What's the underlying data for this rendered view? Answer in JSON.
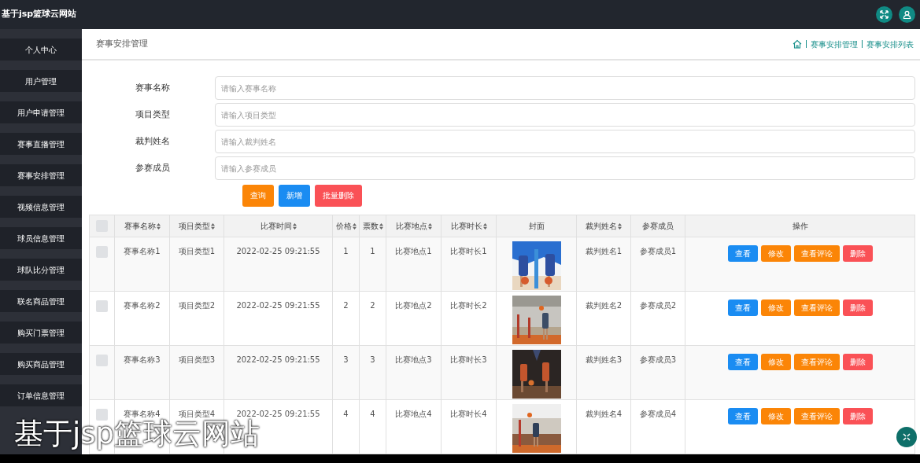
{
  "header": {
    "title": "基于jsp篮球云网站"
  },
  "sidebar": {
    "items": [
      {
        "label": "个人中心"
      },
      {
        "label": "用户管理"
      },
      {
        "label": "用户申请管理"
      },
      {
        "label": "赛事直播管理"
      },
      {
        "label": "赛事安排管理"
      },
      {
        "label": "视频信息管理"
      },
      {
        "label": "球员信息管理"
      },
      {
        "label": "球队比分管理"
      },
      {
        "label": "联名商品管理"
      },
      {
        "label": "购买门票管理"
      },
      {
        "label": "购买商品管理"
      },
      {
        "label": "订单信息管理"
      }
    ]
  },
  "page_title": "赛事安排管理",
  "breadcrumb": [
    "赛事安排管理",
    "赛事安排列表"
  ],
  "search_fields": [
    {
      "label": "赛事名称",
      "placeholder": "请输入赛事名称"
    },
    {
      "label": "项目类型",
      "placeholder": "请输入项目类型"
    },
    {
      "label": "裁判姓名",
      "placeholder": "请输入裁判姓名"
    },
    {
      "label": "参赛成员",
      "placeholder": "请输入参赛成员"
    }
  ],
  "actions": [
    {
      "label": "查询",
      "kind": "warning"
    },
    {
      "label": "新增",
      "kind": "primary"
    },
    {
      "label": "批量删除",
      "kind": "danger"
    }
  ],
  "table": {
    "header_checked": false,
    "columns": [
      {
        "label": "赛事名称",
        "sortable": true
      },
      {
        "label": "项目类型",
        "sortable": true
      },
      {
        "label": "比赛时间",
        "sortable": true
      },
      {
        "label": "价格",
        "sortable": true
      },
      {
        "label": "票数",
        "sortable": true
      },
      {
        "label": "比赛地点",
        "sortable": true
      },
      {
        "label": "比赛时长",
        "sortable": true
      },
      {
        "label": "封面",
        "sortable": false
      },
      {
        "label": "裁判姓名",
        "sortable": true
      },
      {
        "label": "参赛成员",
        "sortable": false
      },
      {
        "label": "操作",
        "sortable": false
      }
    ],
    "rows": [
      {
        "checked": false,
        "cells": [
          {
            "kind": "text",
            "text": "赛事名称1"
          },
          {
            "kind": "text",
            "text": "项目类型1"
          },
          {
            "kind": "text",
            "text": "2022-02-25 09:21:55"
          },
          {
            "kind": "text",
            "text": "1"
          },
          {
            "kind": "text",
            "text": "1"
          },
          {
            "kind": "text",
            "text": "比赛地点1"
          },
          {
            "kind": "text",
            "text": "比赛时长1"
          },
          {
            "kind": "picture"
          },
          {
            "kind": "text",
            "text": "裁判姓名1"
          },
          {
            "kind": "text",
            "text": "参赛成员1"
          }
        ],
        "buttons": [
          {
            "label": "查看",
            "kind": "primary"
          },
          {
            "label": "修改",
            "kind": "warning"
          },
          {
            "label": "查看评论",
            "kind": "warning"
          },
          {
            "label": "删除",
            "kind": "danger"
          }
        ]
      },
      {
        "checked": false,
        "cells": [
          {
            "kind": "text",
            "text": "赛事名称2"
          },
          {
            "kind": "text",
            "text": "项目类型2"
          },
          {
            "kind": "text",
            "text": "2022-02-25 09:21:55"
          },
          {
            "kind": "text",
            "text": "2"
          },
          {
            "kind": "text",
            "text": "2"
          },
          {
            "kind": "text",
            "text": "比赛地点2"
          },
          {
            "kind": "text",
            "text": "比赛时长2"
          },
          {
            "kind": "picture"
          },
          {
            "kind": "text",
            "text": "裁判姓名2"
          },
          {
            "kind": "text",
            "text": "参赛成员2"
          }
        ],
        "buttons": [
          {
            "label": "查看",
            "kind": "primary"
          },
          {
            "label": "修改",
            "kind": "warning"
          },
          {
            "label": "查看评论",
            "kind": "warning"
          },
          {
            "label": "删除",
            "kind": "danger"
          }
        ]
      },
      {
        "checked": false,
        "cells": [
          {
            "kind": "text",
            "text": "赛事名称3"
          },
          {
            "kind": "text",
            "text": "项目类型3"
          },
          {
            "kind": "text",
            "text": "2022-02-25 09:21:55"
          },
          {
            "kind": "text",
            "text": "3"
          },
          {
            "kind": "text",
            "text": "3"
          },
          {
            "kind": "text",
            "text": "比赛地点3"
          },
          {
            "kind": "text",
            "text": "比赛时长3"
          },
          {
            "kind": "picture"
          },
          {
            "kind": "text",
            "text": "裁判姓名3"
          },
          {
            "kind": "text",
            "text": "参赛成员3"
          }
        ],
        "buttons": [
          {
            "label": "查看",
            "kind": "primary"
          },
          {
            "label": "修改",
            "kind": "warning"
          },
          {
            "label": "查看评论",
            "kind": "warning"
          },
          {
            "label": "删除",
            "kind": "danger"
          }
        ]
      },
      {
        "checked": false,
        "cells": [
          {
            "kind": "text",
            "text": "赛事名称4"
          },
          {
            "kind": "text",
            "text": "项目类型4"
          },
          {
            "kind": "text",
            "text": "2022-02-25 09:21:55"
          },
          {
            "kind": "text",
            "text": "4"
          },
          {
            "kind": "text",
            "text": "4"
          },
          {
            "kind": "text",
            "text": "比赛地点4"
          },
          {
            "kind": "text",
            "text": "比赛时长4"
          },
          {
            "kind": "picture"
          },
          {
            "kind": "text",
            "text": "裁判姓名4"
          },
          {
            "kind": "text",
            "text": "参赛成员4"
          }
        ],
        "buttons": [
          {
            "label": "查看",
            "kind": "primary"
          },
          {
            "label": "修改",
            "kind": "warning"
          },
          {
            "label": "查看评论",
            "kind": "warning"
          },
          {
            "label": "删除",
            "kind": "danger"
          }
        ]
      }
    ]
  },
  "caption": "基于jsp篮球云网站"
}
